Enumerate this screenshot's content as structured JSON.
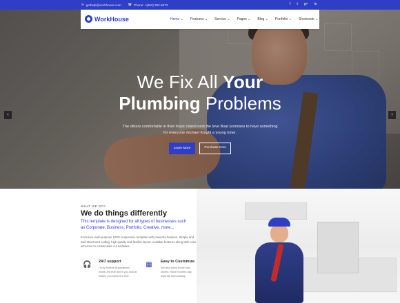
{
  "topbar": {
    "email": "gethelp@workhouse.com",
    "phone": "Phone: +(963) 352-5873",
    "social": [
      "f",
      "t",
      "g+",
      "in"
    ]
  },
  "header": {
    "logo": "WorkHouse",
    "nav": [
      "Home",
      "Features",
      "Service",
      "Pages",
      "Blog",
      "Portfolio",
      "Shortcode"
    ]
  },
  "hero": {
    "title_line1_light": "We Fix All ",
    "title_line1_bold": "Your",
    "title_line2_bold": "Plumbing",
    "title_line2_light": " Problems",
    "text": "The others comfortable in their tropic island nest the love Boat promises to have something for everyone michael Knight a young loner.",
    "primary_button": "Learn More",
    "secondary_button": "Purchase Now",
    "prev_arrow": "‹",
    "next_arrow": "›"
  },
  "about": {
    "eyebrow": "WHAT WE DO?",
    "title": "We do things differently",
    "lead": "This template is designed for all types of businesses such as Corporate, Business, Portfolio, Creative, more...",
    "body": "Exclusive multi-purpose 100% responsive template with powerful features. Simple and well-structured coding, high quality and flexible layout, scalable features along with color schemes to create tailor-cut websites.",
    "features": [
      {
        "icon": "headset-icon",
        "title": "24/7 support",
        "desc": "I truly believe Augustene's words are true and if you look at history you know it is true."
      },
      {
        "icon": "blueprint-icon",
        "title": "Easy to Customize",
        "desc": "We also know those epic stories, those modern-day legends surrounding."
      }
    ]
  },
  "colors": {
    "accent": "#2e3fc6"
  }
}
